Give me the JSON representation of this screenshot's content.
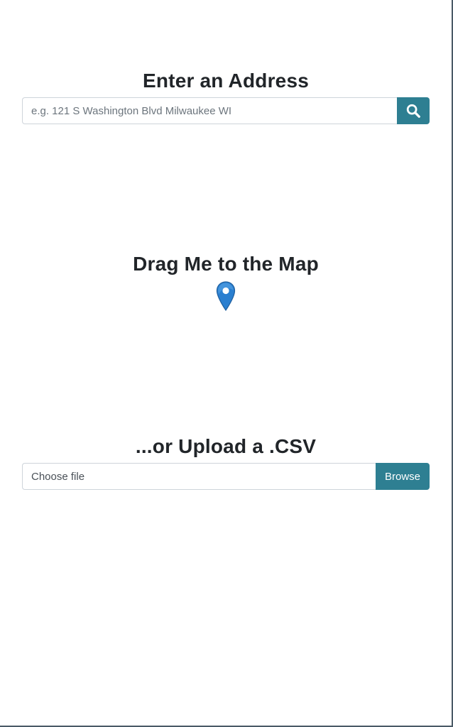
{
  "address_section": {
    "title": "Enter an Address",
    "search_placeholder": "e.g. 121 S Washington Blvd Milwaukee WI",
    "search_icon": "search-icon"
  },
  "drag_section": {
    "title": "Drag Me to the Map",
    "marker_icon": "map-marker-icon"
  },
  "upload_section": {
    "title": "...or Upload a .CSV",
    "file_label": "Choose file",
    "browse_label": "Browse"
  },
  "colors": {
    "accent": "#2e7f92",
    "marker": "#2a7fd0",
    "text": "#212529"
  }
}
